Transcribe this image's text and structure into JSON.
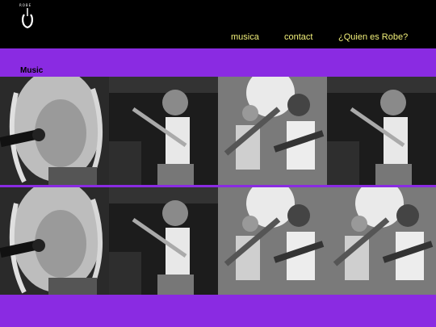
{
  "header": {
    "logo_lettering": "ROBE",
    "nav": [
      {
        "label": "musica"
      },
      {
        "label": "contact"
      },
      {
        "label": "¿Quien es Robe?"
      }
    ]
  },
  "section": {
    "title": "Music"
  },
  "gallery": {
    "rows": [
      [
        {
          "subject": "singer-closeup-microphone"
        },
        {
          "subject": "guitarist-stage-white-tank"
        },
        {
          "subject": "two-guitarists-stage-lights"
        },
        {
          "subject": "guitarist-stage-white-tank"
        }
      ],
      [
        {
          "subject": "singer-closeup-microphone"
        },
        {
          "subject": "guitarist-stage-white-tank"
        },
        {
          "subject": "two-guitarists-stage-lights"
        },
        {
          "subject": "two-guitarists-stage-lights"
        }
      ]
    ]
  },
  "colors": {
    "header_bg": "#000000",
    "page_bg": "#8a2be2",
    "nav_text": "#f2f07a"
  }
}
